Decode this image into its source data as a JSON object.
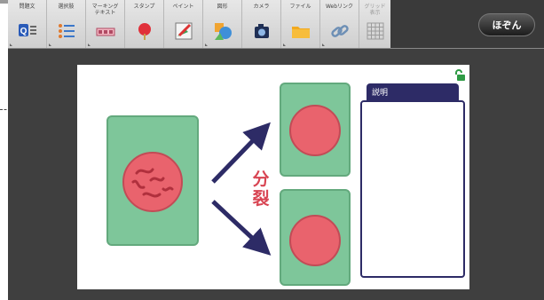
{
  "toolbar": {
    "tools": [
      {
        "name": "mondaibun",
        "label": "問題文"
      },
      {
        "name": "sentakushi",
        "label": "選択肢"
      },
      {
        "name": "marking-text",
        "label": "マーキング\nテキスト"
      },
      {
        "name": "stamp",
        "label": "スタンプ"
      },
      {
        "name": "paint",
        "label": "ペイント"
      },
      {
        "name": "zukei",
        "label": "図形"
      },
      {
        "name": "camera",
        "label": "カメラ"
      },
      {
        "name": "file",
        "label": "ファイル"
      },
      {
        "name": "weblink",
        "label": "Webリンク"
      },
      {
        "name": "grid",
        "label": "グリッド\n表示"
      }
    ],
    "save_label": "ほぞん"
  },
  "slide": {
    "division_label": "分裂",
    "explanation_title": "説明"
  },
  "colors": {
    "card_green": "#7ec69a",
    "cell_red": "#e9636d",
    "arrow_navy": "#2d2b66",
    "division_text": "#d84452"
  }
}
